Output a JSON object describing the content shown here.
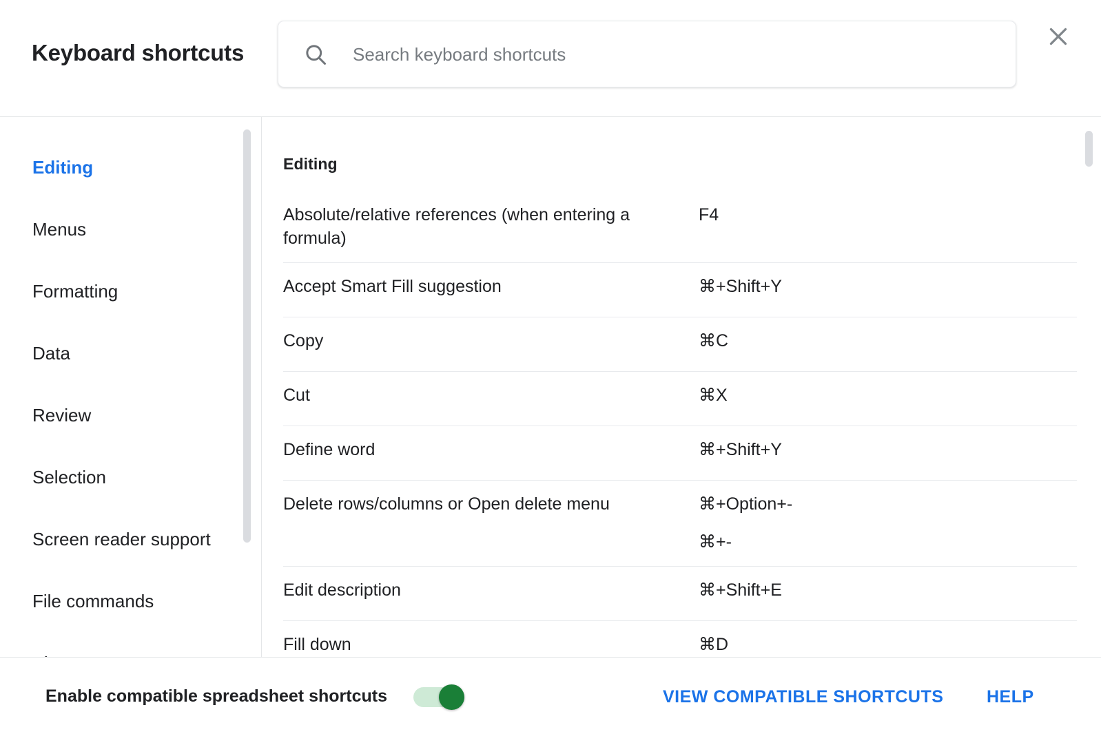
{
  "header": {
    "title": "Keyboard shortcuts",
    "search": {
      "placeholder": "Search keyboard shortcuts",
      "value": "",
      "icon": "search-icon"
    },
    "close_icon": "close-icon"
  },
  "sidebar": {
    "items": [
      {
        "label": "Editing",
        "active": true
      },
      {
        "label": "Menus",
        "active": false
      },
      {
        "label": "Formatting",
        "active": false
      },
      {
        "label": "Data",
        "active": false
      },
      {
        "label": "Review",
        "active": false
      },
      {
        "label": "Selection",
        "active": false
      },
      {
        "label": "Screen reader support",
        "active": false
      },
      {
        "label": "File commands",
        "active": false
      },
      {
        "label": "View",
        "active": false
      }
    ]
  },
  "content": {
    "section_title": "Editing",
    "rows": [
      {
        "description": "Absolute/relative references (when entering a formula)",
        "keys": [
          "F4"
        ],
        "info": false
      },
      {
        "description": "Accept Smart Fill suggestion",
        "keys": [
          "⌘+Shift+Y"
        ],
        "info": false
      },
      {
        "description": "Copy",
        "keys": [
          "⌘C"
        ],
        "info": false
      },
      {
        "description": "Cut",
        "keys": [
          "⌘X"
        ],
        "info": false
      },
      {
        "description": "Define word",
        "keys": [
          "⌘+Shift+Y"
        ],
        "info": false
      },
      {
        "description": "Delete rows/columns or Open delete menu",
        "keys": [
          "⌘+Option+-",
          "⌘+-"
        ],
        "info": true
      },
      {
        "description": "Edit description",
        "keys": [
          "⌘+Shift+E"
        ],
        "info": false
      },
      {
        "description": "Fill down",
        "keys": [
          "⌘D"
        ],
        "info": false
      }
    ]
  },
  "footer": {
    "toggle_label": "Enable compatible spreadsheet shortcuts",
    "toggle_on": true,
    "view_compatible_label": "VIEW COMPATIBLE SHORTCUTS",
    "help_label": "HELP"
  },
  "colors": {
    "accent_blue": "#1b73e8",
    "toggle_green": "#1a7f37",
    "toggle_track_green": "#ceead6",
    "text_primary": "#202124",
    "divider": "#e8eaed"
  }
}
